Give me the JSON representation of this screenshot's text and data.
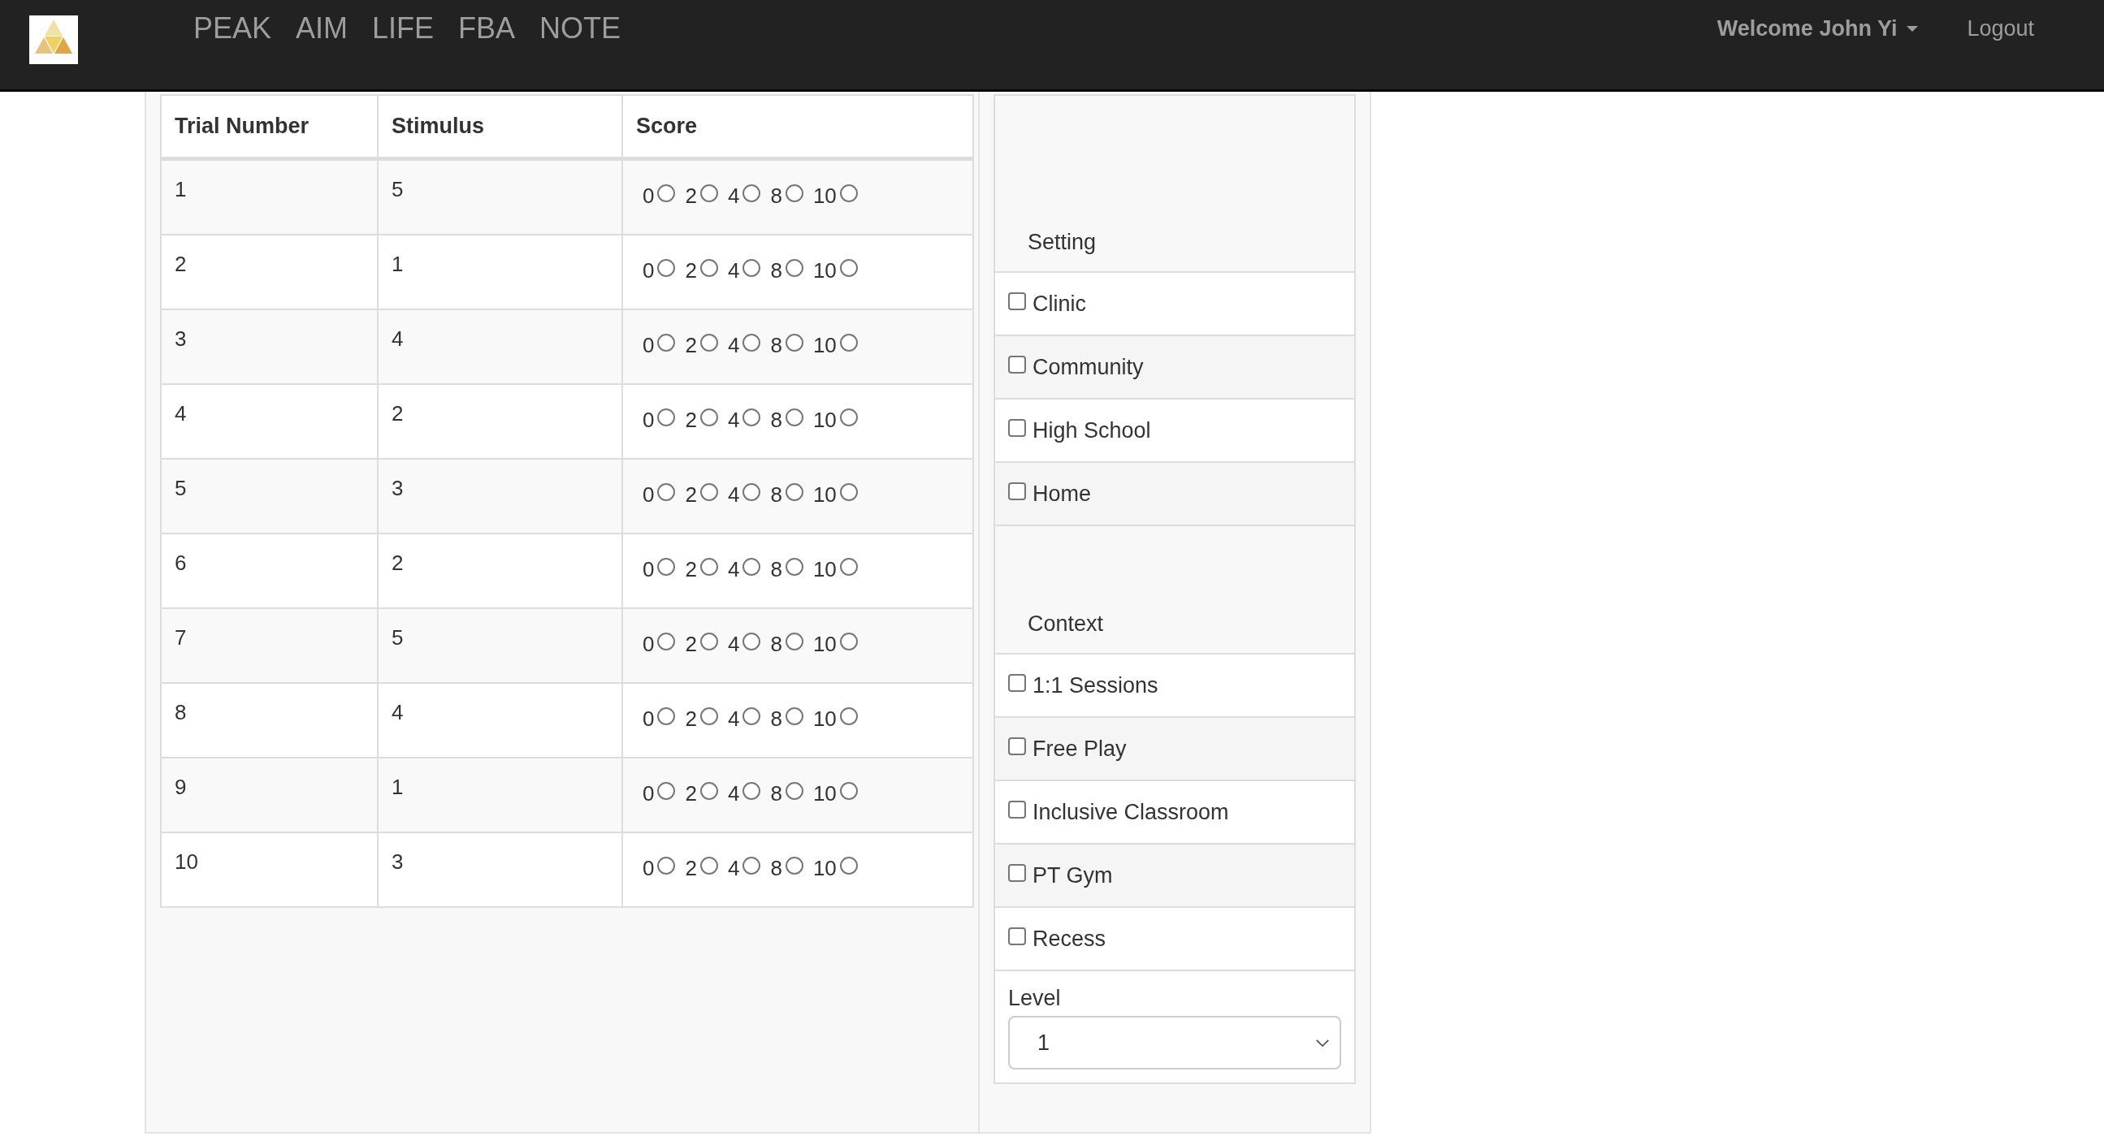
{
  "navbar": {
    "links": [
      "PEAK",
      "AIM",
      "LIFE",
      "FBA",
      "NOTE"
    ],
    "user_menu": "Welcome John Yi",
    "logout": "Logout"
  },
  "table": {
    "columns": [
      "Trial Number",
      "Stimulus",
      "Score"
    ],
    "rows": [
      {
        "trial": "1",
        "stimulus": "5",
        "scores": [
          {
            "label": "0",
            "selected": false
          },
          {
            "label": "2",
            "selected": false
          },
          {
            "label": "4",
            "selected": false
          },
          {
            "label": "8",
            "selected": false
          },
          {
            "label": "10",
            "selected": false
          }
        ]
      },
      {
        "trial": "2",
        "stimulus": "1",
        "scores": [
          {
            "label": "0",
            "selected": false
          },
          {
            "label": "2",
            "selected": false
          },
          {
            "label": "4",
            "selected": false
          },
          {
            "label": "8",
            "selected": false
          },
          {
            "label": "10",
            "selected": false
          }
        ]
      },
      {
        "trial": "3",
        "stimulus": "4",
        "scores": [
          {
            "label": "0",
            "selected": false
          },
          {
            "label": "2",
            "selected": false
          },
          {
            "label": "4",
            "selected": false
          },
          {
            "label": "8",
            "selected": false
          },
          {
            "label": "10",
            "selected": false
          }
        ]
      },
      {
        "trial": "4",
        "stimulus": "2",
        "scores": [
          {
            "label": "0",
            "selected": false
          },
          {
            "label": "2",
            "selected": false
          },
          {
            "label": "4",
            "selected": false
          },
          {
            "label": "8",
            "selected": false
          },
          {
            "label": "10",
            "selected": false
          }
        ]
      },
      {
        "trial": "5",
        "stimulus": "3",
        "scores": [
          {
            "label": "0",
            "selected": false
          },
          {
            "label": "2",
            "selected": false
          },
          {
            "label": "4",
            "selected": false
          },
          {
            "label": "8",
            "selected": false
          },
          {
            "label": "10",
            "selected": false
          }
        ]
      },
      {
        "trial": "6",
        "stimulus": "2",
        "scores": [
          {
            "label": "0",
            "selected": false
          },
          {
            "label": "2",
            "selected": false
          },
          {
            "label": "4",
            "selected": false
          },
          {
            "label": "8",
            "selected": false
          },
          {
            "label": "10",
            "selected": false
          }
        ]
      },
      {
        "trial": "7",
        "stimulus": "5",
        "scores": [
          {
            "label": "0",
            "selected": false
          },
          {
            "label": "2",
            "selected": false
          },
          {
            "label": "4",
            "selected": false
          },
          {
            "label": "8",
            "selected": false
          },
          {
            "label": "10",
            "selected": false
          }
        ]
      },
      {
        "trial": "8",
        "stimulus": "4",
        "scores": [
          {
            "label": "0",
            "selected": false
          },
          {
            "label": "2",
            "selected": false
          },
          {
            "label": "4",
            "selected": false
          },
          {
            "label": "8",
            "selected": false
          },
          {
            "label": "10",
            "selected": false
          }
        ]
      },
      {
        "trial": "9",
        "stimulus": "1",
        "scores": [
          {
            "label": "0",
            "selected": false
          },
          {
            "label": "2",
            "selected": false
          },
          {
            "label": "4",
            "selected": false
          },
          {
            "label": "8",
            "selected": false
          },
          {
            "label": "10",
            "selected": false
          }
        ]
      },
      {
        "trial": "10",
        "stimulus": "3",
        "scores": [
          {
            "label": "0",
            "selected": false
          },
          {
            "label": "2",
            "selected": false
          },
          {
            "label": "4",
            "selected": false
          },
          {
            "label": "8",
            "selected": false
          },
          {
            "label": "10",
            "selected": false
          }
        ]
      }
    ]
  },
  "panel": {
    "groups": [
      {
        "title": "Setting",
        "options": [
          {
            "label": "Clinic",
            "checked": false
          },
          {
            "label": "Community",
            "checked": false
          },
          {
            "label": "High School",
            "checked": false
          },
          {
            "label": "Home",
            "checked": false
          }
        ]
      },
      {
        "title": "Context",
        "options": [
          {
            "label": "1:1 Sessions",
            "checked": false
          },
          {
            "label": "Free Play",
            "checked": false
          },
          {
            "label": "Inclusive Classroom",
            "checked": false
          },
          {
            "label": "PT Gym",
            "checked": false
          },
          {
            "label": "Recess",
            "checked": false
          }
        ]
      }
    ],
    "level": {
      "label": "Level",
      "value": "1"
    }
  }
}
